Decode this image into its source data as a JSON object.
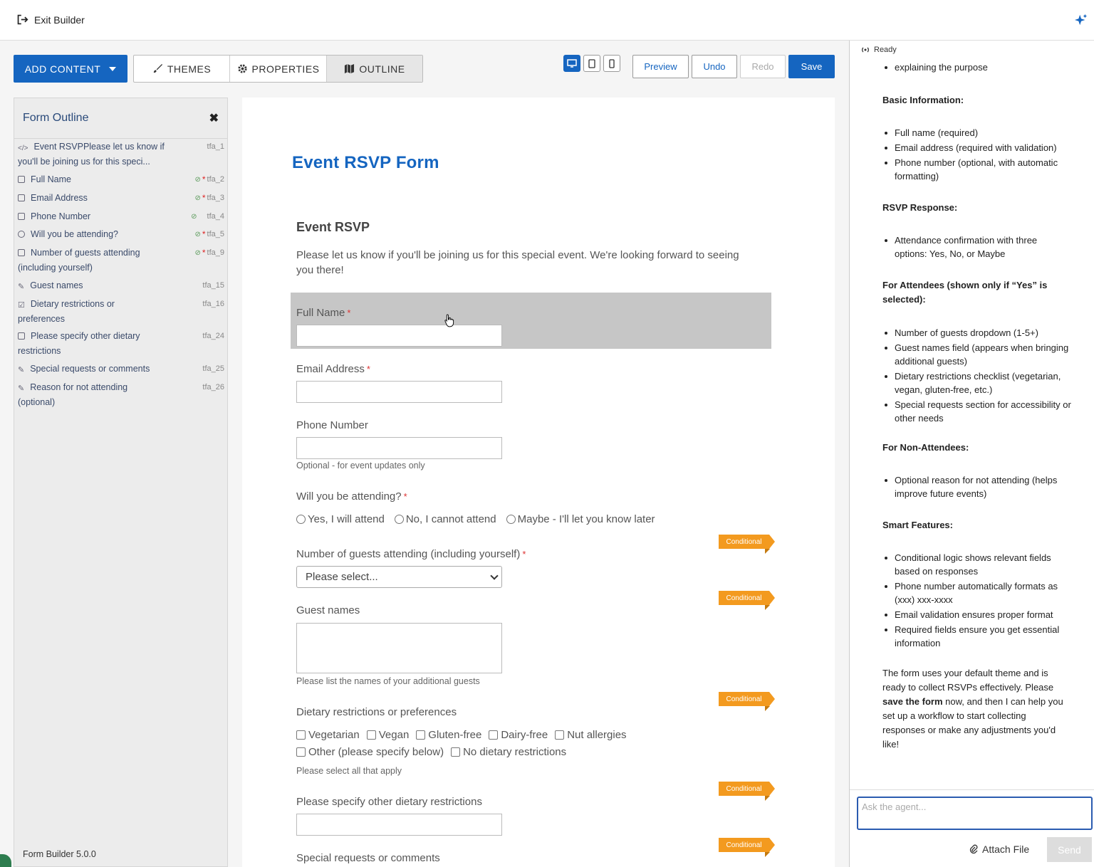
{
  "topbar": {
    "exit_label": "Exit Builder"
  },
  "toolbar": {
    "add_content": "ADD CONTENT",
    "tabs": [
      "THEMES",
      "PROPERTIES",
      "OUTLINE"
    ],
    "preview": "Preview",
    "undo": "Undo",
    "redo": "Redo",
    "save": "Save"
  },
  "outline": {
    "title": "Form Outline",
    "items": [
      {
        "text": "Event RSVPPlease let us know if you'll be joining us for this speci...",
        "id": "tfa_1"
      },
      {
        "text": "Full Name",
        "id": "tfa_2"
      },
      {
        "text": "Email Address",
        "id": "tfa_3"
      },
      {
        "text": "Phone Number",
        "id": "tfa_4"
      },
      {
        "text": "Will you be attending?",
        "id": "tfa_5"
      },
      {
        "text": "Number of guests attending (including yourself)",
        "id": "tfa_9"
      },
      {
        "text": "Guest names",
        "id": "tfa_15"
      },
      {
        "text": "Dietary restrictions or preferences",
        "id": "tfa_16"
      },
      {
        "text": "Please specify other dietary restrictions",
        "id": "tfa_24"
      },
      {
        "text": "Special requests or comments",
        "id": "tfa_25"
      },
      {
        "text": "Reason for not attending (optional)",
        "id": "tfa_26"
      }
    ],
    "version": "Form Builder 5.0.0"
  },
  "form": {
    "title": "Event RSVP Form",
    "section": "Event RSVP",
    "intro": "Please let us know if you'll be joining us for this special event. We're looking forward to seeing you there!",
    "full_name": "Full Name",
    "email": "Email Address",
    "phone": "Phone Number",
    "phone_help": "Optional - for event updates only",
    "attending": "Will you be attending?",
    "attending_options": [
      "Yes, I will attend",
      "No, I cannot attend",
      "Maybe - I'll let you know later"
    ],
    "guests": "Number of guests attending (including yourself)",
    "guests_select": "Please select...",
    "guest_names": "Guest names",
    "guest_names_help": "Please list the names of your additional guests",
    "dietary": "Dietary restrictions or preferences",
    "dietary_options_row1": [
      "Vegetarian",
      "Vegan",
      "Gluten-free",
      "Dairy-free",
      "Nut allergies"
    ],
    "dietary_options_row2": [
      "Other (please specify below)",
      "No dietary restrictions"
    ],
    "dietary_help": "Please select all that apply",
    "other_dietary": "Please specify other dietary restrictions",
    "special": "Special requests or comments",
    "required_mark": "*",
    "conditional": "Conditional"
  },
  "chat": {
    "status": "Ready",
    "top_line": "explaining the purpose",
    "basic_h": "Basic Information:",
    "basic": [
      "Full name (required)",
      "Email address (required with validation)",
      "Phone number (optional, with automatic formatting)"
    ],
    "rsvp_h": "RSVP Response:",
    "rsvp": [
      "Attendance confirmation with three options: Yes, No, or Maybe"
    ],
    "attendees_h": "For Attendees (shown only if “Yes” is selected):",
    "attendees": [
      "Number of guests dropdown (1-5+)",
      "Guest names field (appears when bringing additional guests)",
      "Dietary restrictions checklist (vegetarian, vegan, gluten-free, etc.)",
      "Special requests section for accessibility or other needs"
    ],
    "non_h": "For Non-Attendees:",
    "non": [
      "Optional reason for not attending (helps improve future events)"
    ],
    "smart_h": "Smart Features:",
    "smart": [
      "Conditional logic shows relevant fields based on responses",
      "Phone number automatically formats as (xxx) xxx-xxxx",
      "Email validation ensures proper format",
      "Required fields ensure you get essential information"
    ],
    "closing_a": "The form uses your default theme and is ready to collect RSVPs effectively. Please ",
    "closing_b": "save the form",
    "closing_c": " now, and then I can help you set up a workflow to start collecting responses or make any adjustments you'd like!",
    "placeholder": "Ask the agent...",
    "attach": "Attach File",
    "send": "Send"
  },
  "colors": {
    "accent": "#1565c0",
    "conditional": "#f39a1f",
    "highlight": "#c6c6c6"
  }
}
